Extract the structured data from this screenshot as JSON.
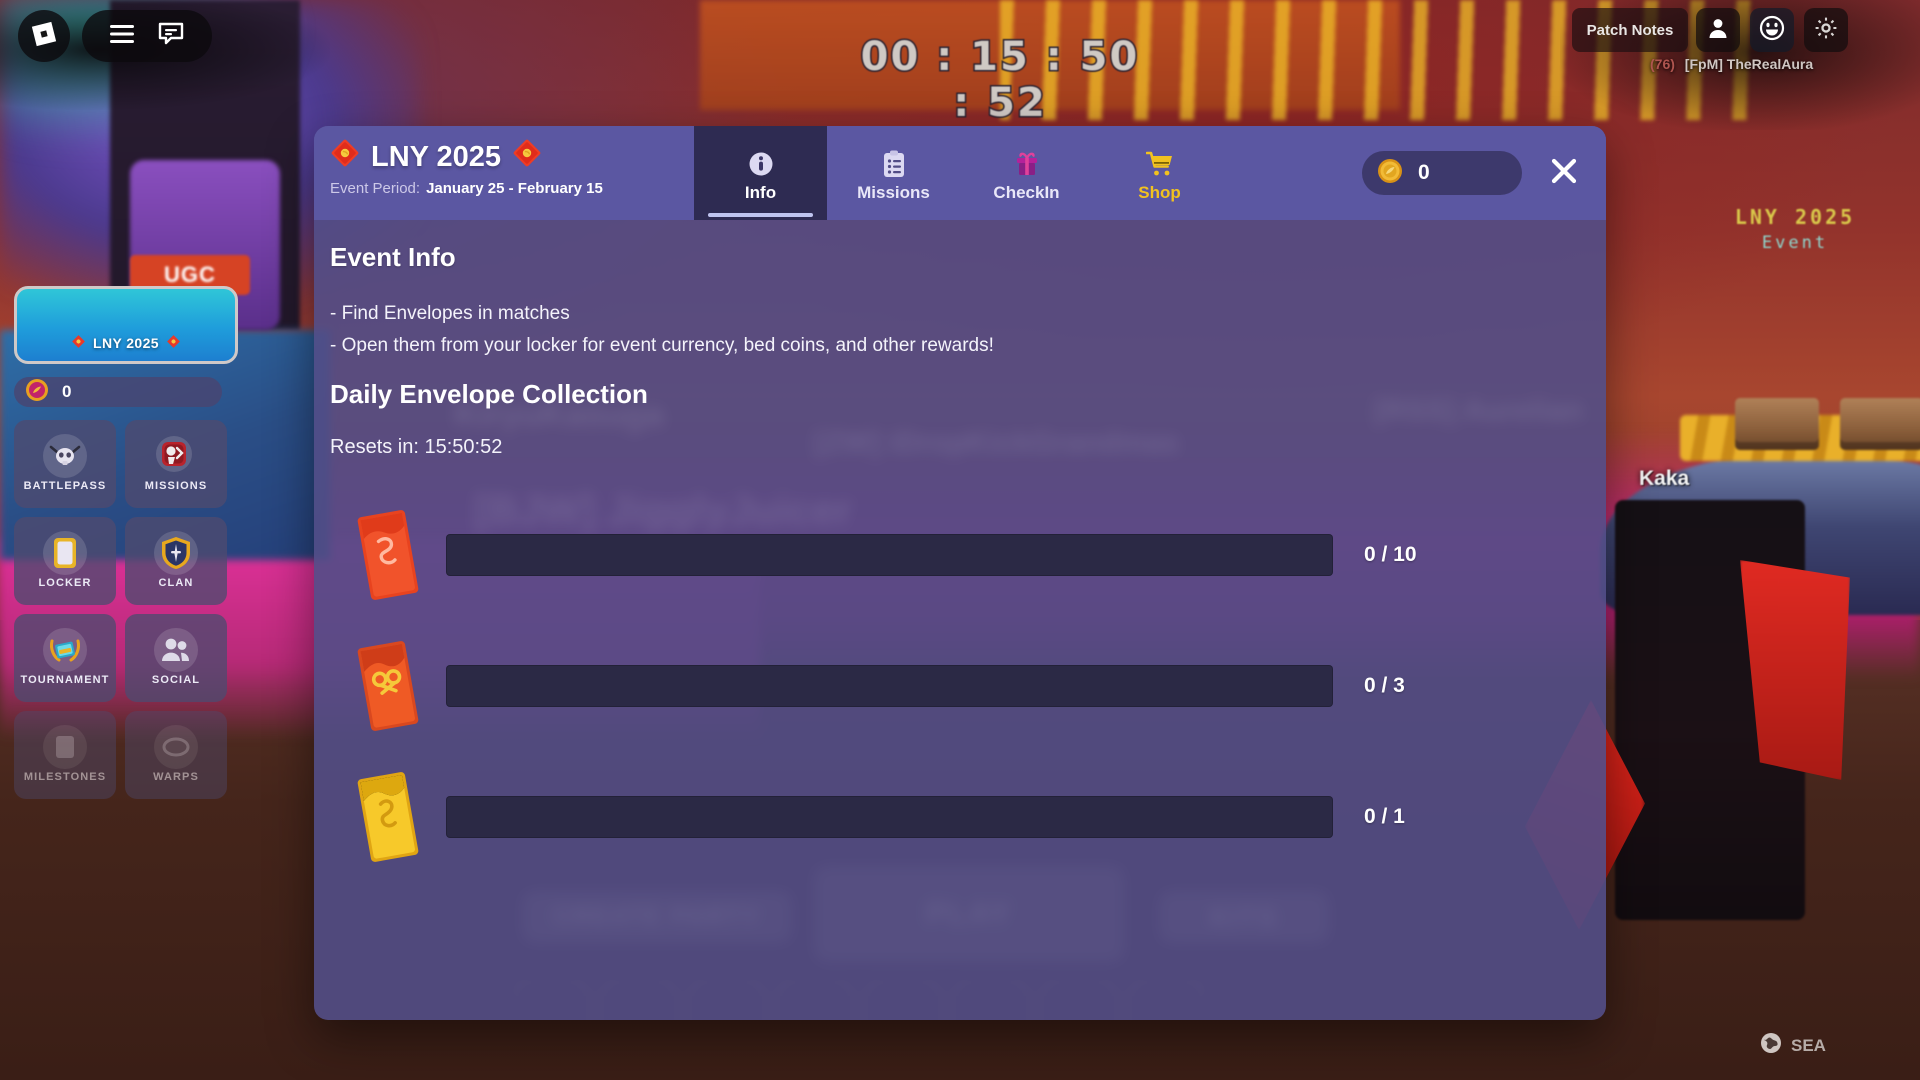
{
  "roblox_topbar": {
    "logo_icon": "roblox-logo-icon",
    "menu_icon": "hamburger-menu-icon",
    "chat_icon": "chat-bubble-icon",
    "patch_notes_label": "Patch Notes",
    "person_icon": "person-icon",
    "emote_icon": "smiley-emote-icon",
    "gear_icon": "gear-icon"
  },
  "player": {
    "level": "(76)",
    "name": "[FpM] TheRealAura"
  },
  "world": {
    "timer": "00 : 15 : 50 : 52",
    "event_sign_title": "LNY 2025",
    "event_sign_sub": "Event",
    "nearby_player": "Kaka",
    "region_label": "SEA",
    "region_icon": "globe-icon"
  },
  "left_menu": {
    "banner_label": "LNY 2025",
    "banner_icon": "red-envelope-icon",
    "currency_icon": "event-coin-icon",
    "currency_value": "0",
    "tiles": [
      {
        "label": "BATTLEPASS",
        "icon": "battlepass-skull-icon",
        "faded": false
      },
      {
        "label": "MISSIONS",
        "icon": "missions-badge-icon",
        "faded": false
      },
      {
        "label": "LOCKER",
        "icon": "locker-card-icon",
        "faded": false
      },
      {
        "label": "CLAN",
        "icon": "clan-shield-icon",
        "faded": false
      },
      {
        "label": "TOURNAMENT",
        "icon": "tournament-trophy-icon",
        "faded": false
      },
      {
        "label": "SOCIAL",
        "icon": "social-people-icon",
        "faded": false
      },
      {
        "label": "MILESTONES",
        "icon": "milestones-icon",
        "faded": true
      },
      {
        "label": "WARPS",
        "icon": "warps-icon",
        "faded": true
      }
    ]
  },
  "event_panel": {
    "title": "LNY 2025",
    "title_icon": "red-envelope-icon",
    "period_label": "Event Period:",
    "period_value": "January 25 - February 15",
    "tabs": [
      {
        "label": "Info",
        "icon": "info-circle-icon",
        "active": true
      },
      {
        "label": "Missions",
        "icon": "clipboard-list-icon",
        "active": false
      },
      {
        "label": "CheckIn",
        "icon": "gift-box-icon",
        "active": false
      },
      {
        "label": "Shop",
        "icon": "shopping-cart-icon",
        "active": false
      }
    ],
    "coin_icon": "gold-coin-icon",
    "coin_value": "0",
    "close_icon": "close-x-icon",
    "section_title": "Event Info",
    "info_lines": [
      "- Find Envelopes in matches",
      "- Open them from your locker for event currency, bed coins, and other rewards!"
    ],
    "daily_title": "Daily Envelope Collection",
    "resets_text": "Resets in: 15:50:52",
    "envelopes": [
      {
        "icon": "red-envelope-common-icon",
        "current": 0,
        "goal": 10,
        "count_text": "0 / 10"
      },
      {
        "icon": "red-envelope-rare-icon",
        "current": 0,
        "goal": 3,
        "count_text": "0 / 3"
      },
      {
        "icon": "gold-envelope-legendary-icon",
        "current": 0,
        "goal": 1,
        "count_text": "0 / 1"
      }
    ]
  },
  "background_ui": {
    "create_party_label": "CREATE PARTY",
    "play_label": "PLAY",
    "kits_label": "KITS",
    "players": [
      "KiryuKasuga",
      "[ZW] iDropKickGrandmas",
      "[RSS] Aurelian",
      "[BJW] JigglyJuicer"
    ]
  },
  "colors": {
    "panel_bg": "#524e87",
    "panel_header": "#5b57a2",
    "tab_active": "#2e2b52",
    "bar_track": "#2b2945",
    "shop_accent": "#f2c21f",
    "banner_blue": "#1f9ddb"
  }
}
